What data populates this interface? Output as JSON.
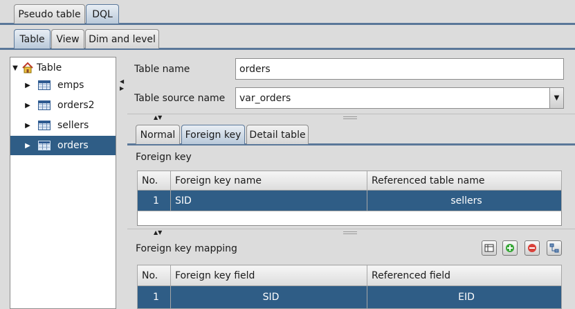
{
  "top_tabs": [
    {
      "label": "Pseudo table",
      "active": false
    },
    {
      "label": "DQL",
      "active": true
    }
  ],
  "sub_tabs": [
    {
      "label": "Table",
      "active": true
    },
    {
      "label": "View",
      "active": false
    },
    {
      "label": "Dim and level",
      "active": false
    }
  ],
  "tree": {
    "root": "Table",
    "items": [
      {
        "label": "emps",
        "selected": false
      },
      {
        "label": "orders2",
        "selected": false
      },
      {
        "label": "sellers",
        "selected": false
      },
      {
        "label": "orders",
        "selected": true
      }
    ]
  },
  "form": {
    "table_name_label": "Table name",
    "table_name_value": "orders",
    "table_source_label": "Table source name",
    "table_source_value": "var_orders"
  },
  "inner_tabs": [
    {
      "label": "Normal",
      "active": false
    },
    {
      "label": "Foreign key",
      "active": true
    },
    {
      "label": "Detail table",
      "active": false
    }
  ],
  "foreign_key": {
    "title": "Foreign key",
    "columns": [
      "No.",
      "Foreign key name",
      "Referenced table name"
    ],
    "rows": [
      [
        "1",
        "SID",
        "sellers"
      ]
    ]
  },
  "mapping": {
    "title": "Foreign key mapping",
    "columns": [
      "No.",
      "Foreign key field",
      "Referenced field"
    ],
    "rows": [
      [
        "1",
        "SID",
        "EID"
      ]
    ]
  },
  "toolbar_icons": [
    "table-edit-icon",
    "add-icon",
    "remove-icon",
    "link-icon"
  ],
  "colors": {
    "selection": "#2f5d86",
    "tab_border": "#5a7799"
  }
}
